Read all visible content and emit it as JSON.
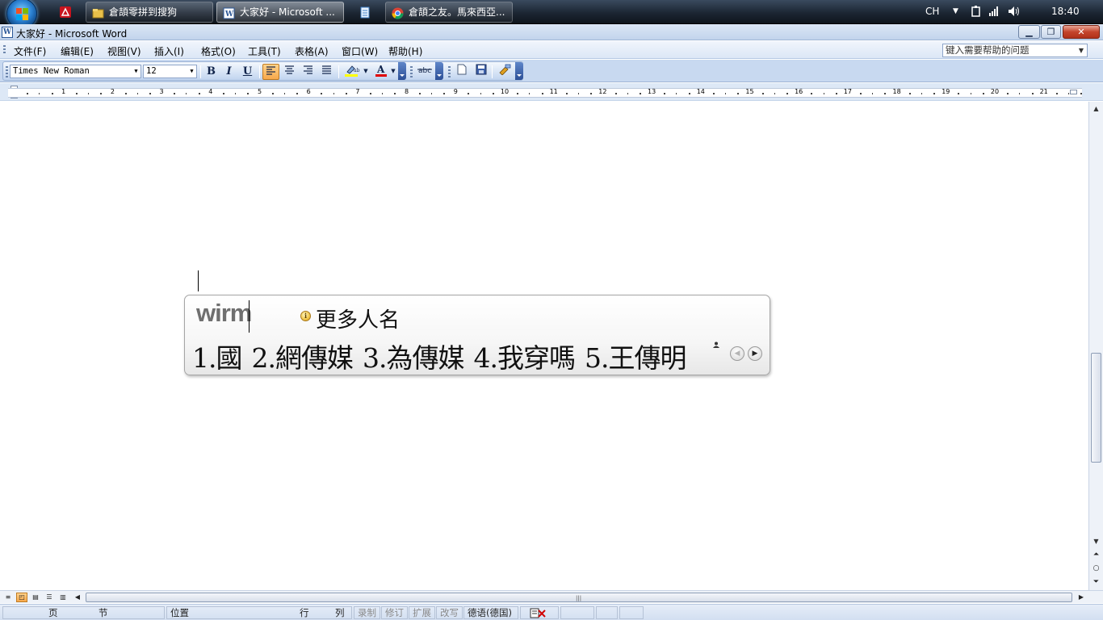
{
  "taskbar": {
    "buttons": [
      {
        "label": "倉頡零拼到搜狗"
      },
      {
        "label": "大家好 - Microsoft ..."
      },
      {
        "label": "倉頡之友。馬來西亞..."
      }
    ],
    "tray": {
      "language": "CH",
      "time": "18:40"
    }
  },
  "window": {
    "title": "大家好 - Microsoft Word"
  },
  "menubar": {
    "items": [
      {
        "label": "文件(F)"
      },
      {
        "label": "编辑(E)"
      },
      {
        "label": "视图(V)"
      },
      {
        "label": "插入(I)"
      },
      {
        "label": "格式(O)"
      },
      {
        "label": "工具(T)"
      },
      {
        "label": "表格(A)"
      },
      {
        "label": "窗口(W)"
      },
      {
        "label": "帮助(H)"
      }
    ],
    "help_placeholder": "键入需要帮助的问题"
  },
  "toolbar": {
    "font_name": "Times New Roman",
    "font_size": "12",
    "bold": "B",
    "italic": "I",
    "underline": "U",
    "font_color": "#e00000",
    "highlight_color": "#ffff00"
  },
  "ruler": {
    "numbers": [
      "1",
      "2",
      "3",
      "4",
      "5",
      "6",
      "7",
      "8",
      "9",
      "10",
      "11",
      "12",
      "13",
      "14",
      "15",
      "16",
      "17",
      "18",
      "19",
      "20",
      "21"
    ]
  },
  "ime": {
    "composition": "wirm",
    "hint": "更多人名",
    "candidates": [
      {
        "text": "1.國"
      },
      {
        "text": "2.網傳媒"
      },
      {
        "text": "3.為傳媒"
      },
      {
        "text": "4.我穿嗎"
      },
      {
        "text": "5.王傳明"
      }
    ]
  },
  "statusbar": {
    "page": "页",
    "section": "节",
    "position": "位置",
    "line": "行",
    "column": "列",
    "rec": "录制",
    "trk": "修订",
    "ext": "扩展",
    "ovr": "改写",
    "language": "德语(德国)"
  }
}
